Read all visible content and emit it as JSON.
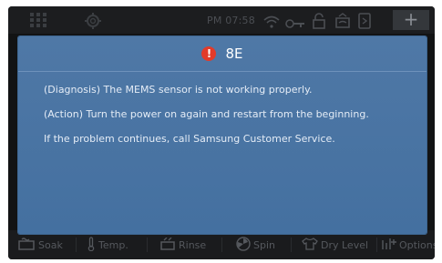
{
  "status_bar": {
    "time": "PM 07:58",
    "icons": [
      "grid-icon",
      "gear-icon",
      "wifi-icon",
      "key-icon",
      "lock-icon",
      "tub-icon",
      "phone-icon"
    ],
    "add_button_label": "+"
  },
  "dialog": {
    "error_code": "8E",
    "error_icon_glyph": "!",
    "lines": [
      "(Diagnosis) The MEMS sensor is not working properly.",
      "(Action) Turn the power on again and restart from the beginning.",
      "If the problem continues, call Samsung Customer Service."
    ]
  },
  "bottom_bar": {
    "items": [
      {
        "label": "Soak",
        "icon": "soak-icon"
      },
      {
        "label": "Temp.",
        "icon": "thermometer-icon"
      },
      {
        "label": "Rinse",
        "icon": "rinse-icon"
      },
      {
        "label": "Spin",
        "icon": "spin-icon"
      },
      {
        "label": "Dry Level",
        "icon": "shirt-icon"
      },
      {
        "label": "Options",
        "icon": "options-icon"
      }
    ]
  },
  "colors": {
    "dialog_bg": "#4a74a3",
    "error_red": "#e23b2a",
    "screen_bg": "#121314"
  }
}
